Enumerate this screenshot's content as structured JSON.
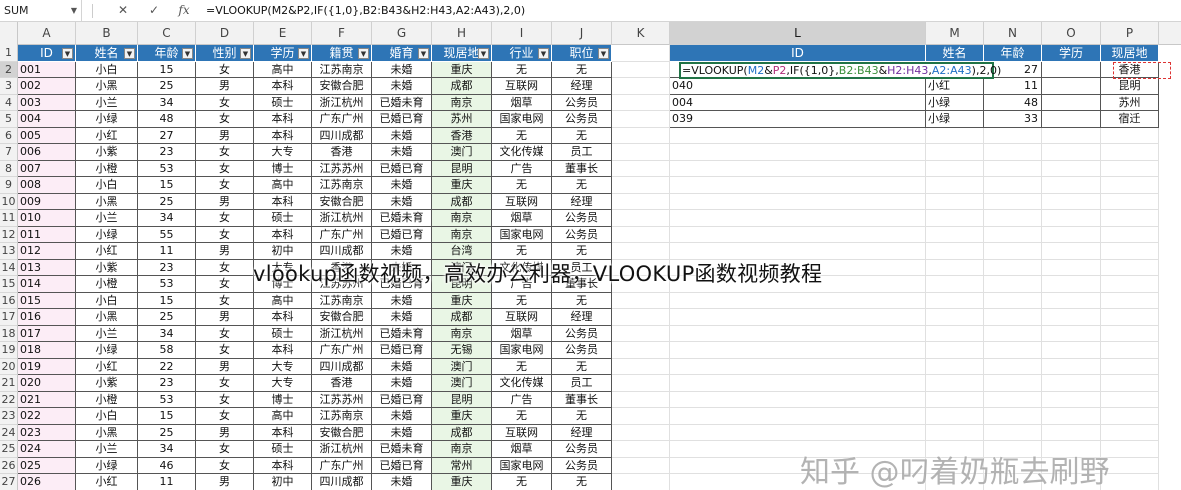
{
  "formula_bar": {
    "name_box": "SUM",
    "cancel": "✕",
    "confirm": "✓",
    "fx": "fx",
    "formula": "=VLOOKUP(M2&P2,IF({1,0},B2:B43&H2:H43,A2:A43),2,0)"
  },
  "columns": [
    "A",
    "B",
    "C",
    "D",
    "E",
    "F",
    "G",
    "H",
    "I",
    "J",
    "K",
    "L",
    "M",
    "N",
    "O",
    "P"
  ],
  "row_numbers": [
    "1",
    "2",
    "3",
    "4",
    "5",
    "6",
    "7",
    "8",
    "9",
    "10",
    "11",
    "12",
    "13",
    "14",
    "15",
    "16",
    "17",
    "18",
    "19",
    "20",
    "21",
    "22",
    "23",
    "24",
    "25",
    "26",
    "27"
  ],
  "headers": [
    "ID",
    "姓名",
    "年龄",
    "性别",
    "学历",
    "籍贯",
    "婚育",
    "现居地",
    "行业",
    "职位"
  ],
  "rows": [
    [
      "001",
      "小白",
      "15",
      "女",
      "高中",
      "江苏南京",
      "未婚",
      "重庆",
      "无",
      "无"
    ],
    [
      "002",
      "小黑",
      "25",
      "男",
      "本科",
      "安徽合肥",
      "未婚",
      "成都",
      "互联网",
      "经理"
    ],
    [
      "003",
      "小兰",
      "34",
      "女",
      "硕士",
      "浙江杭州",
      "已婚未育",
      "南京",
      "烟草",
      "公务员"
    ],
    [
      "004",
      "小绿",
      "48",
      "女",
      "本科",
      "广东广州",
      "已婚已育",
      "苏州",
      "国家电网",
      "公务员"
    ],
    [
      "005",
      "小红",
      "27",
      "男",
      "本科",
      "四川成都",
      "未婚",
      "香港",
      "无",
      "无"
    ],
    [
      "006",
      "小紫",
      "23",
      "女",
      "大专",
      "香港",
      "未婚",
      "澳门",
      "文化传媒",
      "员工"
    ],
    [
      "007",
      "小橙",
      "53",
      "女",
      "博士",
      "江苏苏州",
      "已婚已育",
      "昆明",
      "广告",
      "董事长"
    ],
    [
      "008",
      "小白",
      "15",
      "女",
      "高中",
      "江苏南京",
      "未婚",
      "重庆",
      "无",
      "无"
    ],
    [
      "009",
      "小黑",
      "25",
      "男",
      "本科",
      "安徽合肥",
      "未婚",
      "成都",
      "互联网",
      "经理"
    ],
    [
      "010",
      "小兰",
      "34",
      "女",
      "硕士",
      "浙江杭州",
      "已婚未育",
      "南京",
      "烟草",
      "公务员"
    ],
    [
      "011",
      "小绿",
      "55",
      "女",
      "本科",
      "广东广州",
      "已婚已育",
      "南京",
      "国家电网",
      "公务员"
    ],
    [
      "012",
      "小红",
      "11",
      "男",
      "初中",
      "四川成都",
      "未婚",
      "台湾",
      "无",
      "无"
    ],
    [
      "013",
      "小紫",
      "23",
      "女",
      "大专",
      "香港",
      "未婚",
      "澳门",
      "文化传媒",
      "员工"
    ],
    [
      "014",
      "小橙",
      "53",
      "女",
      "博士",
      "江苏苏州",
      "已婚已育",
      "昆明",
      "广告",
      "董事长"
    ],
    [
      "015",
      "小白",
      "15",
      "女",
      "高中",
      "江苏南京",
      "未婚",
      "重庆",
      "无",
      "无"
    ],
    [
      "016",
      "小黑",
      "25",
      "男",
      "本科",
      "安徽合肥",
      "未婚",
      "成都",
      "互联网",
      "经理"
    ],
    [
      "017",
      "小兰",
      "34",
      "女",
      "硕士",
      "浙江杭州",
      "已婚未育",
      "南京",
      "烟草",
      "公务员"
    ],
    [
      "018",
      "小绿",
      "58",
      "女",
      "本科",
      "广东广州",
      "已婚已育",
      "无锡",
      "国家电网",
      "公务员"
    ],
    [
      "019",
      "小红",
      "22",
      "男",
      "大专",
      "四川成都",
      "未婚",
      "澳门",
      "无",
      "无"
    ],
    [
      "020",
      "小紫",
      "23",
      "女",
      "大专",
      "香港",
      "未婚",
      "澳门",
      "文化传媒",
      "员工"
    ],
    [
      "021",
      "小橙",
      "53",
      "女",
      "博士",
      "江苏苏州",
      "已婚已育",
      "昆明",
      "广告",
      "董事长"
    ],
    [
      "022",
      "小白",
      "15",
      "女",
      "高中",
      "江苏南京",
      "未婚",
      "重庆",
      "无",
      "无"
    ],
    [
      "023",
      "小黑",
      "25",
      "男",
      "本科",
      "安徽合肥",
      "未婚",
      "成都",
      "互联网",
      "经理"
    ],
    [
      "024",
      "小兰",
      "34",
      "女",
      "硕士",
      "浙江杭州",
      "已婚未育",
      "南京",
      "烟草",
      "公务员"
    ],
    [
      "025",
      "小绿",
      "46",
      "女",
      "本科",
      "广东广州",
      "已婚已育",
      "常州",
      "国家电网",
      "公务员"
    ],
    [
      "026",
      "小红",
      "11",
      "男",
      "初中",
      "四川成都",
      "未婚",
      "重庆",
      "无",
      "无"
    ],
    [
      "027",
      "小紫",
      "23",
      "女",
      "大专",
      "香港",
      "未婚",
      "澳门",
      "文化传媒",
      "员工"
    ]
  ],
  "lookup_table": {
    "headers": [
      "ID",
      "姓名",
      "年龄",
      "学历",
      "现居地"
    ],
    "editing_formula_parts": [
      "=VLOOKUP(",
      "M2",
      "&",
      "P2",
      ",IF({1,0},",
      "B2:B43",
      "&",
      "H2:H43",
      ",",
      "A2:A43",
      "),2,0)"
    ],
    "rows": [
      [
        "",
        "",
        "27",
        "",
        "香港"
      ],
      [
        "040",
        "小红",
        "11",
        "",
        "昆明"
      ],
      [
        "004",
        "小绿",
        "48",
        "",
        "苏州"
      ],
      [
        "039",
        "小绿",
        "33",
        "",
        "宿迁"
      ]
    ]
  },
  "overlay_caption": "vlookup函数视频，高效办公利器，VLOOKUP函数视频教程",
  "watermark": "知乎 @叼着奶瓶去刷野",
  "colors": {
    "header_blue": "#2e75b6",
    "id_pink": "#fcedf6",
    "col_h_green": "#e9f6e5",
    "edit_border": "#217346"
  }
}
